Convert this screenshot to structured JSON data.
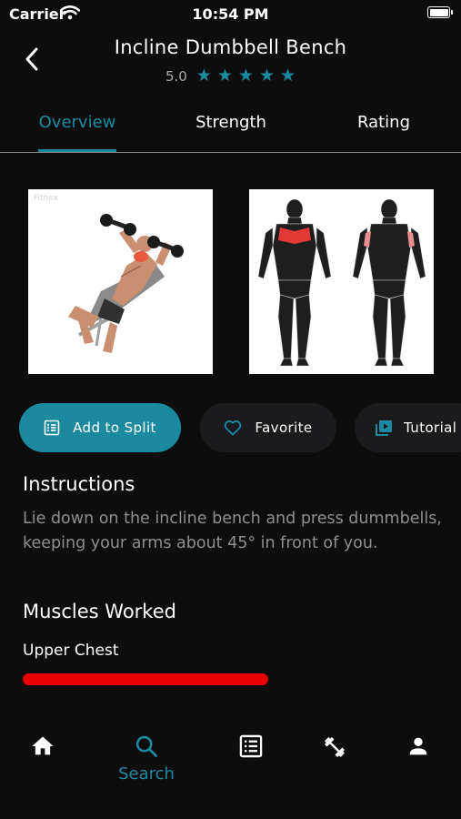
{
  "status_bar": {
    "carrier": "Carrier",
    "time": "10:54 PM"
  },
  "header": {
    "title": "Incline Dumbbell Bench",
    "rating": "5.0",
    "stars": 5
  },
  "tabs": [
    {
      "label": "Overview",
      "active": true
    },
    {
      "label": "Strength",
      "active": false
    },
    {
      "label": "Rating",
      "active": false
    }
  ],
  "images": {
    "exercise_watermark": "Fitnex"
  },
  "actions": [
    {
      "label": "Add to Split",
      "icon": "list-icon"
    },
    {
      "label": "Favorite",
      "icon": "heart-icon"
    },
    {
      "label": "Tutorial",
      "icon": "video-icon"
    }
  ],
  "instructions": {
    "heading": "Instructions",
    "text": "Lie down on the incline bench and press dummbells, keeping your arms about 45° in front of you."
  },
  "muscles": {
    "heading": "Muscles Worked",
    "items": [
      {
        "name": "Upper Chest",
        "level": 1.0
      }
    ]
  },
  "nav": [
    {
      "icon": "home-icon",
      "label": ""
    },
    {
      "icon": "search-icon",
      "label": "Search",
      "active": true
    },
    {
      "icon": "list-icon",
      "label": ""
    },
    {
      "icon": "dumbbell-icon",
      "label": ""
    },
    {
      "icon": "person-icon",
      "label": ""
    }
  ],
  "colors": {
    "accent": "#1b8aa0",
    "background": "#0d0d0e",
    "muscle_bar": "#e90000",
    "muscle_highlight": "#e53935"
  }
}
